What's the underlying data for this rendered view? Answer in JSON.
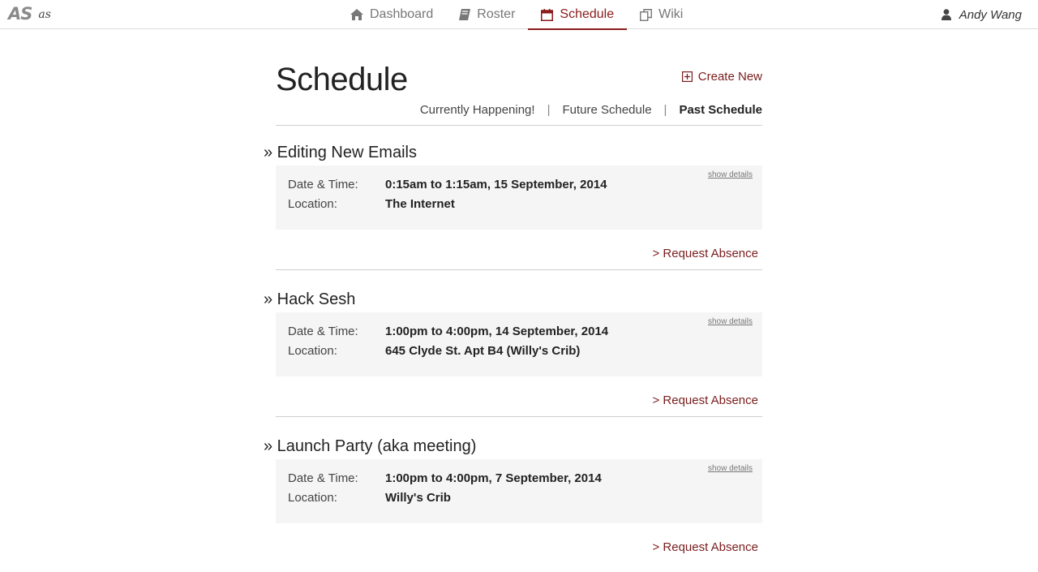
{
  "app": {
    "logo_mark": "AS",
    "logo_text": "as"
  },
  "nav": {
    "items": [
      {
        "label": "Dashboard",
        "icon": "home-icon"
      },
      {
        "label": "Roster",
        "icon": "book-icon"
      },
      {
        "label": "Schedule",
        "icon": "calendar-icon",
        "active": true
      },
      {
        "label": "Wiki",
        "icon": "copy-icon"
      }
    ],
    "user": "Andy Wang"
  },
  "page": {
    "title": "Schedule",
    "create_new": "Create New",
    "subnav": [
      "Currently Happening!",
      "Future Schedule",
      "Past Schedule"
    ],
    "subnav_separator": "|"
  },
  "labels": {
    "date_time": "Date & Time:",
    "location": "Location:",
    "show_details": "show details",
    "request_absence": "> Request Absence"
  },
  "events": [
    {
      "title": "» Editing New Emails",
      "datetime": "0:15am to 1:15am, 15 September, 2014",
      "location": "The Internet"
    },
    {
      "title": "» Hack Sesh",
      "datetime": "1:00pm to 4:00pm, 14 September, 2014",
      "location": "645 Clyde St. Apt B4 (Willy's Crib)"
    },
    {
      "title": "» Launch Party (aka meeting)",
      "datetime": "1:00pm to 4:00pm, 7 September, 2014",
      "location": "Willy's Crib"
    }
  ],
  "colors": {
    "accent": "#8b1a1a",
    "card_bg": "#f5f5f5",
    "rule": "#cfcfcf"
  }
}
